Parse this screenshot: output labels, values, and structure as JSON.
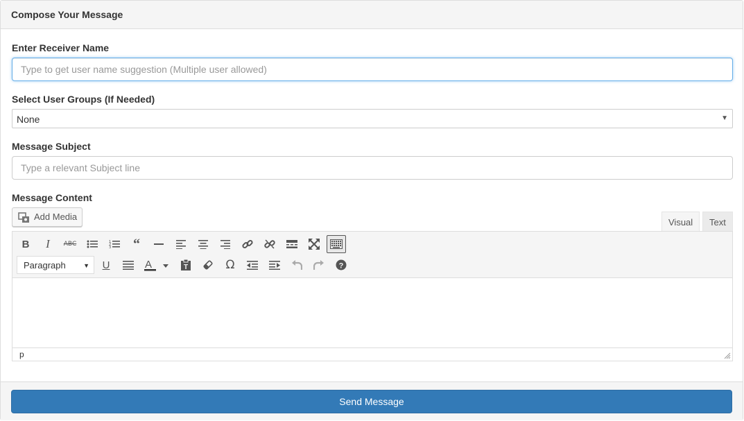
{
  "panel": {
    "title": "Compose Your Message"
  },
  "receiver": {
    "label": "Enter Receiver Name",
    "placeholder": "Type to get user name suggestion (Multiple user allowed)",
    "value": ""
  },
  "groups": {
    "label": "Select User Groups (If Needed)",
    "selected": "None"
  },
  "subject": {
    "label": "Message Subject",
    "placeholder": "Type a relevant Subject line",
    "value": ""
  },
  "content": {
    "label": "Message Content",
    "add_media": "Add Media",
    "tabs": {
      "visual": "Visual",
      "text": "Text"
    },
    "format_selected": "Paragraph",
    "status_path": "p"
  },
  "toolbar_row1": [
    "bold-icon",
    "italic-icon",
    "strikethrough-icon",
    "bulleted-list-icon",
    "numbered-list-icon",
    "blockquote-icon",
    "horizontal-line-icon",
    "align-left-icon",
    "align-center-icon",
    "align-right-icon",
    "insert-link-icon",
    "remove-link-icon",
    "read-more-icon",
    "fullscreen-icon",
    "toolbar-toggle-icon"
  ],
  "toolbar_row2": [
    "underline-icon",
    "justify-icon",
    "text-color-icon",
    "paste-as-text-icon",
    "clear-formatting-icon",
    "special-character-icon",
    "outdent-icon",
    "indent-icon",
    "undo-icon",
    "redo-icon",
    "help-icon"
  ],
  "footer": {
    "send": "Send Message"
  },
  "colors": {
    "primary": "#337ab7",
    "panel_bg": "#f5f5f5",
    "border": "#dddddd",
    "focus": "#66afe9"
  }
}
